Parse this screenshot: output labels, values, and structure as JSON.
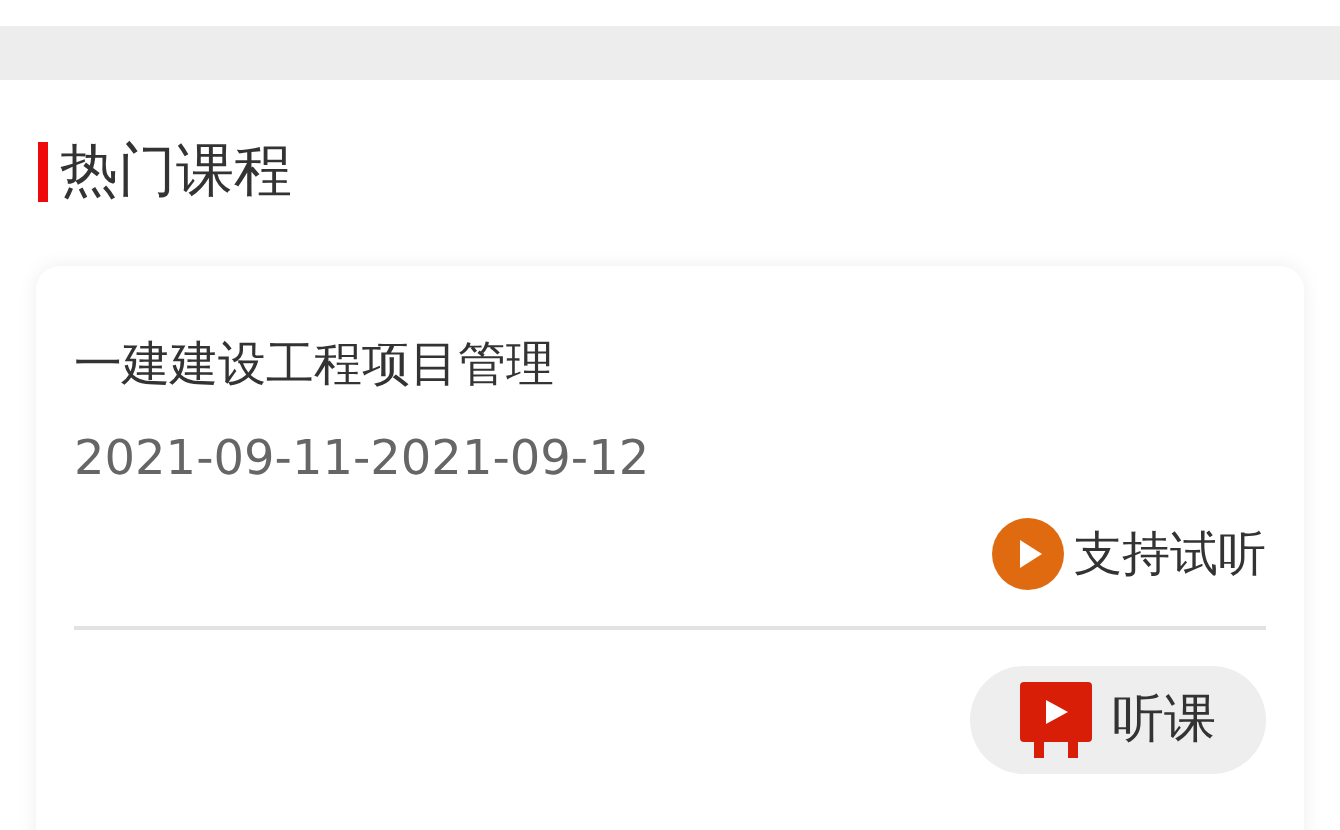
{
  "section": {
    "title": "热门课程"
  },
  "course": {
    "title": "一建建设工程项目管理",
    "dates": "2021-09-11-2021-09-12",
    "trial_label": "支持试听",
    "button_label": "听课"
  }
}
